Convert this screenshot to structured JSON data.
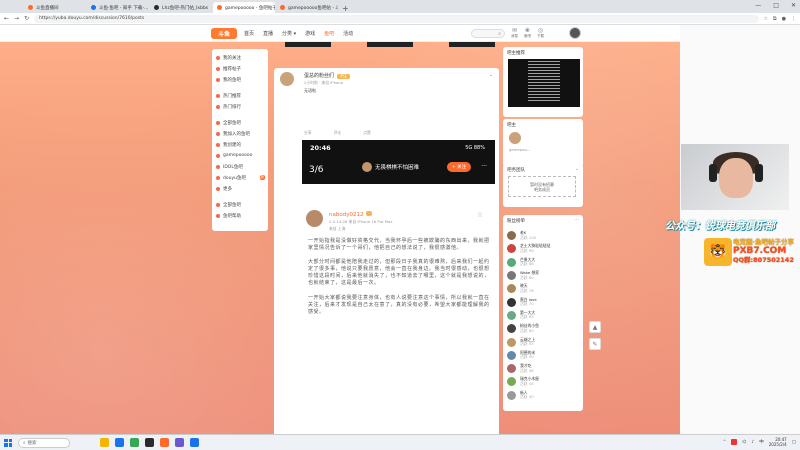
{
  "browser": {
    "tabs": [
      {
        "label": "斗鱼直播间",
        "color": "#ff6a2c",
        "active": false
      },
      {
        "label": "斗鱼·鱼吧 - 知乎 下载-…",
        "color": "#1a73e8",
        "active": false
      },
      {
        "label": "Lhz鱼吧-热门帖_Ixbbs",
        "color": "#2b2b2b",
        "active": false
      },
      {
        "label": "gamepooooo - 鱼吧帖子 …",
        "color": "#ff6a2c",
        "active": true
      },
      {
        "label": "gamepooooo鱼吧帖 - 斗鱼直播 …",
        "color": "#ff6a2c",
        "active": false
      }
    ],
    "url": "https://yuba.douyu.com/discussion/7610/posts"
  },
  "site": {
    "logo": "斗鱼",
    "nav": [
      "首页",
      "直播",
      "分类 ▾",
      "游戏",
      "鱼吧",
      "活动"
    ],
    "nav_active": "鱼吧",
    "header_icons": [
      {
        "glyph": "✉",
        "label": "消息"
      },
      {
        "glyph": "❀",
        "label": "鱼吧"
      },
      {
        "glyph": "◎",
        "label": "下载"
      }
    ]
  },
  "left_sidebar": {
    "items": [
      {
        "label": "我的关注",
        "badge": ""
      },
      {
        "label": "推荐帖子",
        "badge": ""
      },
      {
        "label": "我的鱼吧",
        "badge": ""
      },
      {
        "sep": true
      },
      {
        "label": "热门推荐",
        "badge": ""
      },
      {
        "label": "热门排行",
        "badge": ""
      },
      {
        "sep": true
      },
      {
        "label": "全部鱼吧",
        "badge": ""
      },
      {
        "label": "我加入的鱼吧",
        "badge": ""
      },
      {
        "label": "我创建的",
        "badge": ""
      },
      {
        "label": "gamepooooo",
        "badge": ""
      },
      {
        "label": "IDOL鱼吧",
        "badge": ""
      },
      {
        "label": "douyu鱼吧",
        "badge": "新"
      },
      {
        "label": "更多",
        "badge": ""
      },
      {
        "sep": true
      },
      {
        "label": "全部鱼吧",
        "badge": ""
      },
      {
        "label": "鱼吧帮助",
        "badge": ""
      }
    ]
  },
  "post": {
    "author": "蛋总的粉丝们",
    "author_tag": "吧主",
    "meta": "2小时前 · 来自 iPhone",
    "text": "无语啦",
    "actions": [
      "分享",
      "评论",
      "点赞"
    ]
  },
  "inner_shot": {
    "status_time": "20:46",
    "status_right": "5G 88%",
    "page_counter": "3/6",
    "title": "无畏棋棋不怕困难",
    "follow": "+ 关注",
    "more": "···",
    "inner_author": "nabody0212",
    "inner_meta": "2-4 14:26  来自 iPhone 16 Pro Max",
    "inner_sub": "来自 上海",
    "paragraphs": [
      "一开始指我是没做好资格交代，当我怀孕后一些被欺骗的东西出来，我就把家里情况告诉了一个哥们，他把自己的想法说了，我很感激他。",
      "大部分时间都是他陪我走过的，但那段日子我真的很难熬，后来我们一起约定了很多事，他说只要我愿意，他会一直在我身边。我当时很感动，也很想珍惜这段时间，后来他就消失了，也不知道去了哪里，这个就是我想说的，也就结束了，这是最后一次。",
      "一开始大家都说我要注意身体，也有人说要注意这个事情，所以我就一直在关注，后来才发现是自己太在意了，真的没有必要，希望大家都能理解我的感受。"
    ]
  },
  "right": {
    "card1_title": "吧主推荐",
    "card2_title": "吧主",
    "card2_text": "gamepoo...",
    "card3_title": "吧务团队",
    "card3_text": "暂时没有招募\n吧务成员",
    "fans_title": "粉丝榜单",
    "fans": [
      {
        "name": "老K",
        "sub": "活跃 100",
        "color": "#8a6a4a"
      },
      {
        "name": "芝士大狗哒哒哒哒",
        "sub": "活跃 99",
        "color": "#c44"
      },
      {
        "name": "芒果大大",
        "sub": "活跃 88",
        "color": "#5a7"
      },
      {
        "name": "Woke 想家",
        "sub": "活跃 80",
        "color": "#777"
      },
      {
        "name": "晓天",
        "sub": "活跃 76",
        "color": "#a85"
      },
      {
        "name": "黑白 love",
        "sub": "活跃 70",
        "color": "#333"
      },
      {
        "name": "第一大大",
        "sub": "活跃 65",
        "color": "#6a8"
      },
      {
        "name": "粉丝的小鱼",
        "sub": "活跃 60",
        "color": "#444"
      },
      {
        "name": "云端之上",
        "sub": "活跃 55",
        "color": "#b96"
      },
      {
        "name": "阿德的米",
        "sub": "活跃 50",
        "color": "#68a"
      },
      {
        "name": "我才吃",
        "sub": "活跃 48",
        "color": "#a66"
      },
      {
        "name": "瑞克小木屋",
        "sub": "活跃 45",
        "color": "#7a5"
      },
      {
        "name": "新人",
        "sub": "活跃 40",
        "color": "#999"
      }
    ]
  },
  "overlay": {
    "gzh": "公众号：锐球电竞俱乐部",
    "promo_line1": "电竞圈·鱼吧帖子分享",
    "promo_line2": "PXB7.COM",
    "promo_line3": "QQ群:807502142"
  },
  "taskbar": {
    "search": "搜索",
    "apps": [
      "#f5b400",
      "#1a73e8",
      "#34a853",
      "#2b2b2b",
      "#ff6a2c",
      "#6a5acd",
      "#1a73e8"
    ],
    "lang": "中",
    "time": "20:47",
    "date": "2025/2/4"
  }
}
